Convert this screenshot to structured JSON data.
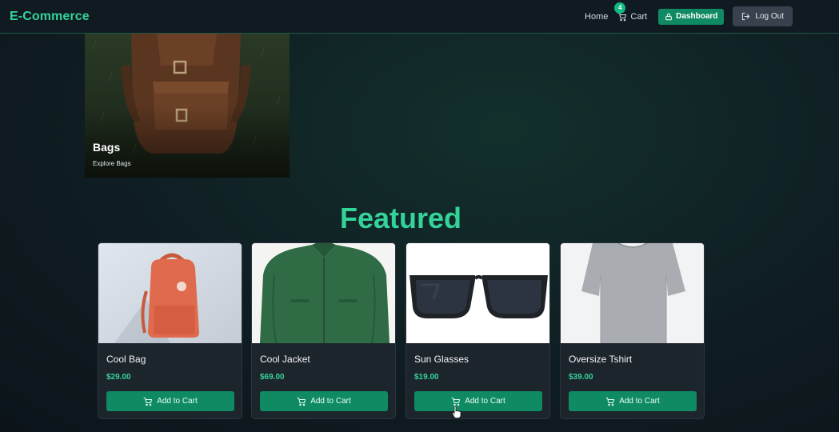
{
  "navbar": {
    "brand": "E-Commerce",
    "home_label": "Home",
    "cart_label": "Cart",
    "cart_count": "4",
    "dashboard_label": "Dashboard",
    "logout_label": "Log Out"
  },
  "category": {
    "name": "Bags",
    "subtitle": "Explore Bags"
  },
  "featured": {
    "title": "Featured",
    "products": [
      {
        "name": "Cool Bag",
        "price": "$29.00",
        "button": "Add to Cart"
      },
      {
        "name": "Cool Jacket",
        "price": "$69.00",
        "button": "Add to Cart"
      },
      {
        "name": "Sun Glasses",
        "price": "$19.00",
        "button": "Add to Cart"
      },
      {
        "name": "Oversize Tshirt",
        "price": "$39.00",
        "button": "Add to Cart"
      }
    ]
  },
  "icons": {
    "cart": "cart-icon",
    "lock": "lock-icon",
    "logout": "logout-icon",
    "cursor": "hand-pointer-icon"
  },
  "colors": {
    "accent": "#34d399",
    "button": "#0f8a63",
    "background": "#0f1d22"
  }
}
